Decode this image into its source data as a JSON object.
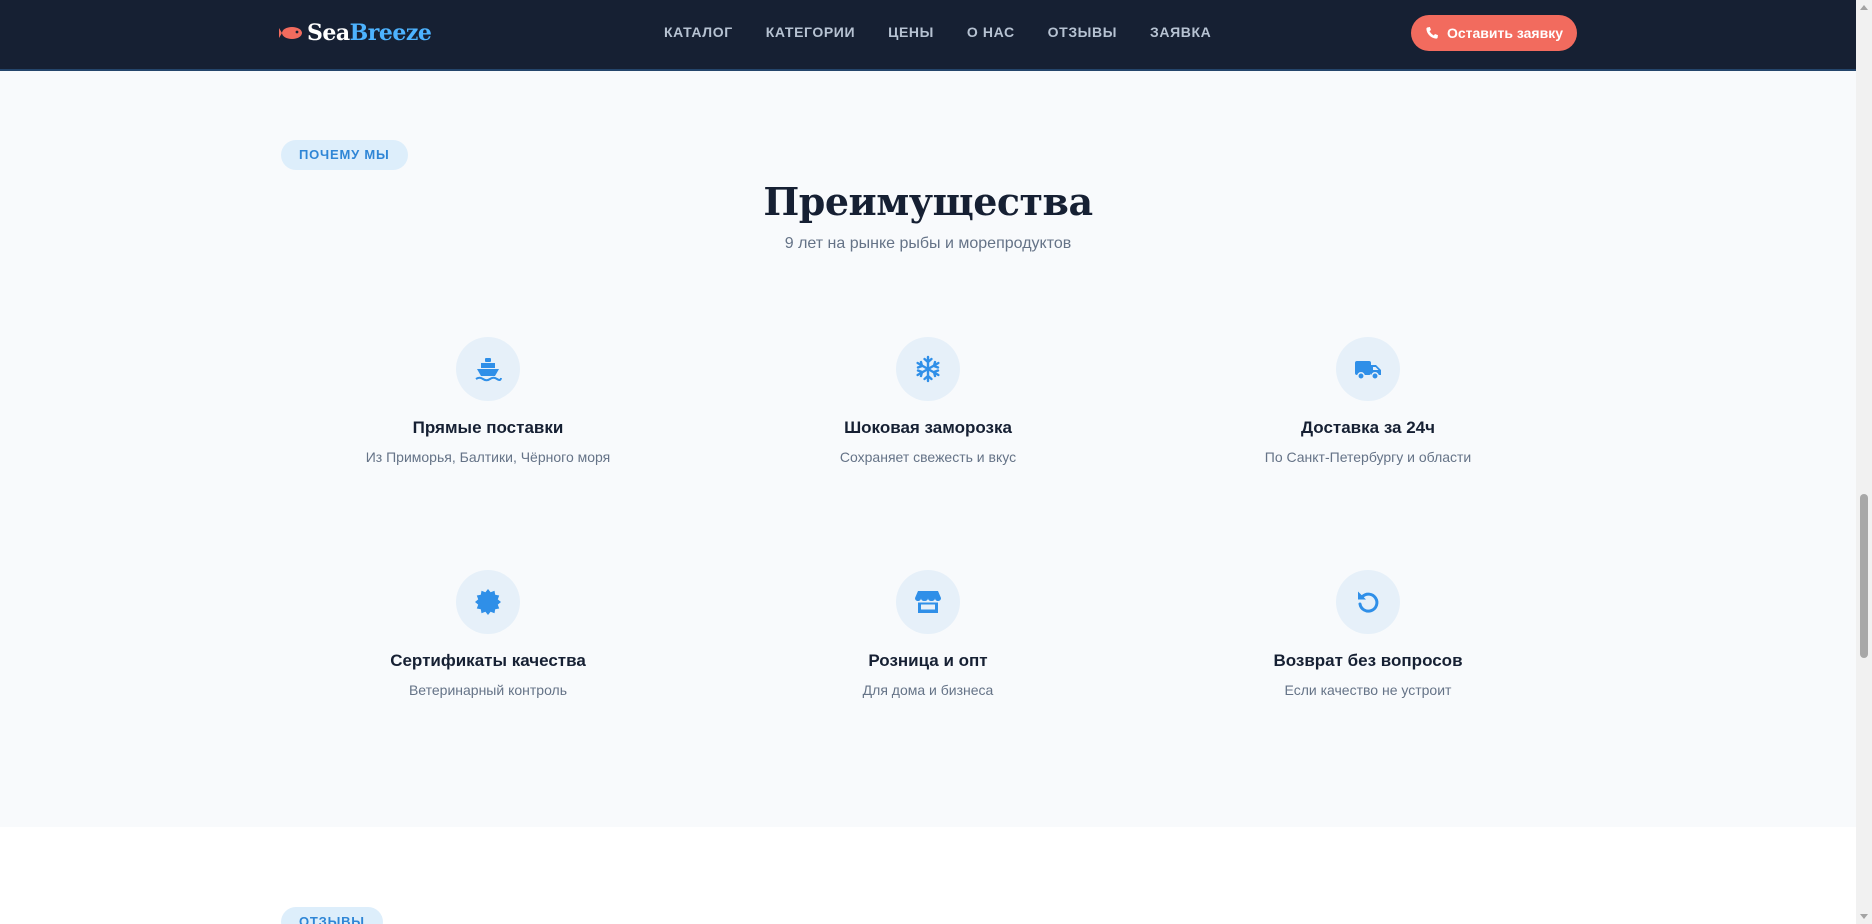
{
  "header": {
    "logo": {
      "sea": "Sea",
      "breeze": "Breeze",
      "icon": "fish-icon"
    },
    "nav": [
      "КАТАЛОГ",
      "КАТЕГОРИИ",
      "ЦЕНЫ",
      "О НАС",
      "ОТЗЫВЫ",
      "ЗАЯВКА"
    ],
    "cta_label": "Оставить заявку",
    "cta_icon": "phone-icon"
  },
  "advantages": {
    "pill": "ПОЧЕМУ МЫ",
    "title": "Преимущества",
    "subtitle": "9 лет на рынке рыбы и морепродуктов",
    "items": [
      {
        "icon": "ship-icon",
        "title": "Прямые поставки",
        "desc": "Из Приморья, Балтики, Чёрного моря"
      },
      {
        "icon": "snowflake-icon",
        "title": "Шоковая заморозка",
        "desc": "Сохраняет свежесть и вкус"
      },
      {
        "icon": "truck-icon",
        "title": "Доставка за 24ч",
        "desc": "По Санкт-Петербургу и области"
      },
      {
        "icon": "certificate-icon",
        "title": "Сертификаты качества",
        "desc": "Ветеринарный контроль"
      },
      {
        "icon": "store-icon",
        "title": "Розница и опт",
        "desc": "Для дома и бизнеса"
      },
      {
        "icon": "undo-icon",
        "title": "Возврат без вопросов",
        "desc": "Если качество не устроит"
      }
    ]
  },
  "reviews": {
    "pill": "ОТЗЫВЫ"
  },
  "colors": {
    "header_bg": "#162033",
    "accent": "#f26b5e",
    "brand_blue": "#4db3ff",
    "icon_blue": "#2f8fe8",
    "section_bg": "#f8fafc"
  }
}
